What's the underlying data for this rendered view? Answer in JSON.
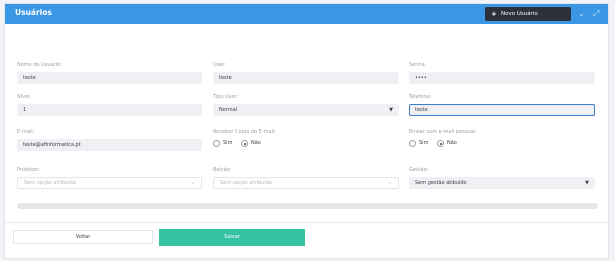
{
  "header": {
    "title": "Usuários",
    "new_button_label": "Novo Usuário",
    "new_button_icon": "plus-icon"
  },
  "form": {
    "nome": {
      "label": "Nome do Usuário:",
      "value": "teste"
    },
    "user": {
      "label": "User:",
      "value": "teste"
    },
    "senha": {
      "label": "Senha:",
      "value": "••••"
    },
    "nivel": {
      "label": "Nível:",
      "value": "1"
    },
    "tipo_user": {
      "label": "Tipo User:",
      "value": "Normal"
    },
    "telefone": {
      "label": "Telefone:",
      "value": "teste"
    },
    "email": {
      "label": "E-mail:",
      "value": "teste@afinformatica.pt"
    },
    "receber_copia": {
      "label": "Receber Copia do E-mail:",
      "options": [
        "Sim",
        "Não"
      ],
      "selected": "Não"
    },
    "enviar_pessoal": {
      "label": "Enviar com e-mail pessoal:",
      "options": [
        "Sim",
        "Não"
      ],
      "selected": "Não"
    },
    "produtor": {
      "label": "Produtor:",
      "placeholder": "Sem opção atribuída"
    },
    "balcao": {
      "label": "Balcão:",
      "placeholder": "Sem opção atribuída"
    },
    "gestao": {
      "label": "Gestão:",
      "value": "Sem gestão atibuído"
    }
  },
  "actions": {
    "back_label": "Voltar",
    "save_label": "Salvar"
  },
  "colors": {
    "header_bg": "#3a97e6",
    "save_bg": "#36c3a4",
    "new_button_bg": "#2b3039"
  }
}
